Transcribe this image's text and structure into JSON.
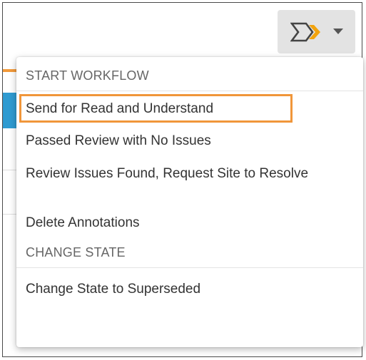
{
  "toolbar": {
    "workflow_icon": "workflow-icon",
    "caret_icon": "caret-down-icon"
  },
  "menu": {
    "start_workflow_header": "START WORKFLOW",
    "start_workflow_items": [
      "Send for Read and Understand",
      "Passed Review with No Issues",
      "Review Issues Found, Request Site to Resolve",
      "Delete Annotations"
    ],
    "change_state_header": "CHANGE STATE",
    "change_state_items": [
      "Change State to Superseded"
    ]
  },
  "colors": {
    "highlight_border": "#f0963a",
    "button_bg": "#e3e3e3",
    "icon_color": "#444444",
    "icon_accent": "#f2a30c"
  }
}
